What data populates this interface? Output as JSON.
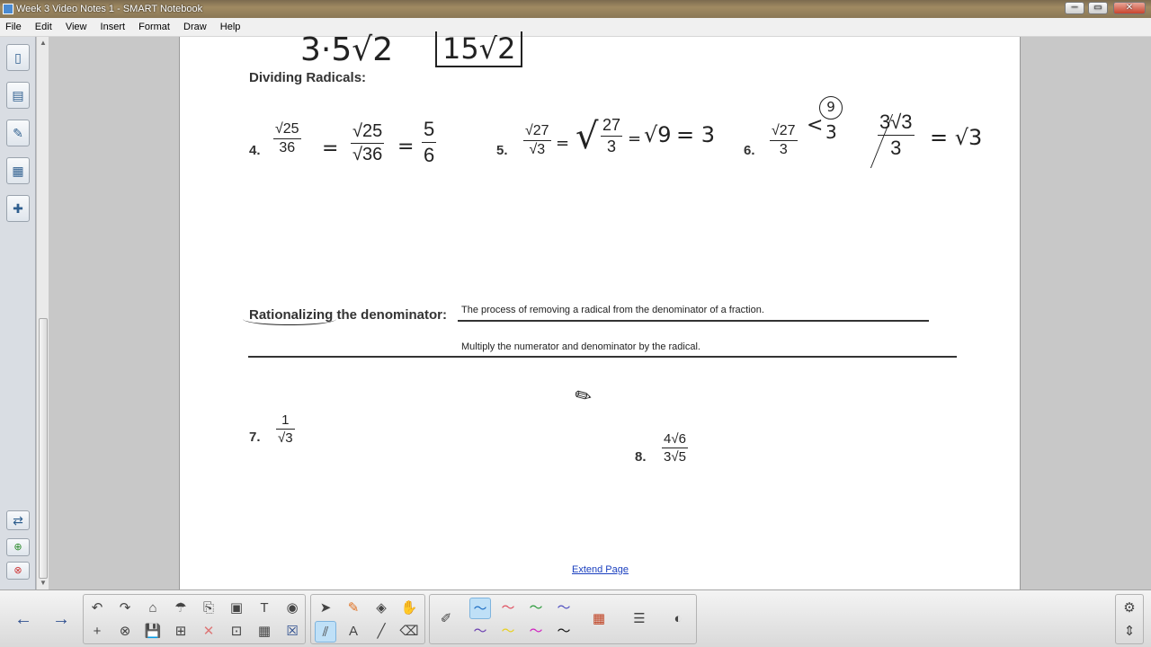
{
  "window": {
    "title": "Week 3 Video Notes 1 - SMART Notebook",
    "minimize": "─",
    "restore": "▭",
    "close": "✕"
  },
  "menu": {
    "items": [
      "File",
      "Edit",
      "View",
      "Insert",
      "Format",
      "Draw",
      "Help"
    ]
  },
  "page": {
    "top_work": "3·5√2",
    "top_boxed": "15√2",
    "section_dividing": "Dividing Radicals:",
    "p4": {
      "num": "4.",
      "expr_n": "√25",
      "expr_d": "36",
      "step_n": "√25",
      "step_d": "√36",
      "eq1": "=",
      "eq2": "=",
      "ans_n": "5",
      "ans_d": "6"
    },
    "p5": {
      "num": "5.",
      "expr_n": "√27",
      "expr_d": "√3",
      "eq": "=",
      "step_n": "27",
      "step_d": "3",
      "step_eq": "=",
      "step2": "√9",
      "step2_eq": "= 3"
    },
    "p6": {
      "num": "6.",
      "expr_n": "√27",
      "expr_d": "3",
      "branch": "<",
      "circled": "9",
      "branch_d": "3",
      "work_n": "3√3",
      "work_d": "3",
      "result": "= √3"
    },
    "section_rationalizing": "Rationalizing the denominator:",
    "definition": "The process of removing a radical from the denominator of a fraction.",
    "method": "Multiply the numerator and denominator by the radical.",
    "p7": {
      "num": "7.",
      "n": "1",
      "d": "√3"
    },
    "p8": {
      "num": "8.",
      "n": "4√6",
      "d": "3√5"
    },
    "extend_page": "Extend Page"
  },
  "toolbar": {
    "nav": [
      "←",
      "→"
    ],
    "actions": [
      "↶",
      "↷",
      "⌂",
      "☂",
      "⎘",
      "▣",
      "T",
      "◉",
      "+",
      "⊗",
      "💾",
      "⊞",
      "✕",
      "⊡",
      "▦",
      "☒"
    ],
    "tools": [
      "➤",
      "✎",
      "◈",
      "✋",
      "⫽",
      "A",
      "╱",
      "⌫"
    ],
    "pens": [
      "〜",
      "〜",
      "〜",
      "〜",
      "〜",
      "〜",
      "〜",
      "〜"
    ],
    "extras": [
      "✐",
      "▦",
      "☰",
      "◐"
    ],
    "side": [
      "⚙",
      "⇕"
    ]
  },
  "colors": {
    "link": "#1a3fbf",
    "selection": "#bfe0f7"
  }
}
